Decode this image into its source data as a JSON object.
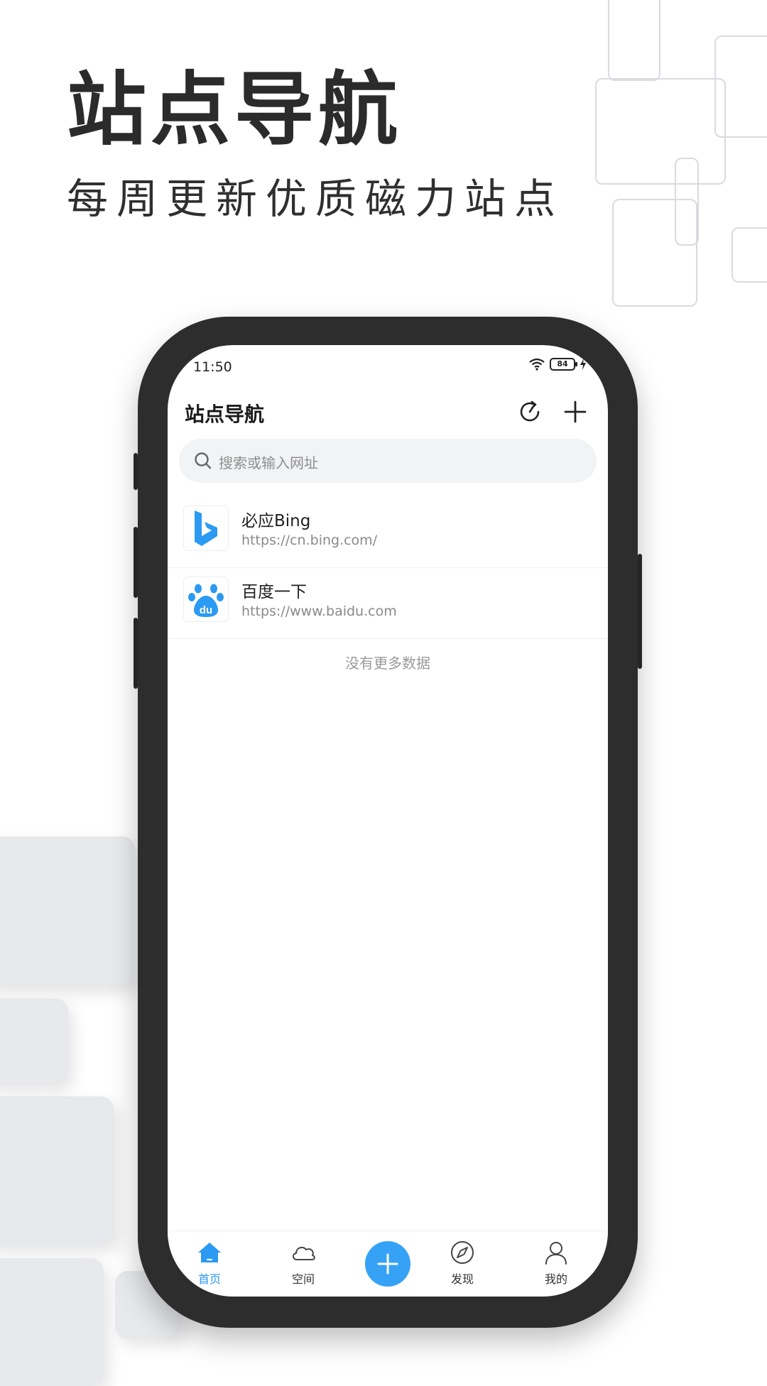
{
  "promo": {
    "title": "站点导航",
    "subtitle": "每周更新优质磁力站点"
  },
  "status_bar": {
    "time": "11:50",
    "battery": "84"
  },
  "app": {
    "title": "站点导航",
    "search_placeholder": "搜索或输入网址",
    "sites": [
      {
        "name": "必应Bing",
        "url": "https://cn.bing.com/",
        "icon": "bing-logo"
      },
      {
        "name": "百度一下",
        "url": "https://www.baidu.com",
        "icon": "baidu-logo"
      }
    ],
    "list_end_text": "没有更多数据"
  },
  "tabbar": {
    "tabs": [
      {
        "label": "首页",
        "icon": "home-icon",
        "active": true
      },
      {
        "label": "空间",
        "icon": "cloud-icon",
        "active": false
      },
      {
        "label": "发现",
        "icon": "compass-icon",
        "active": false
      },
      {
        "label": "我的",
        "icon": "user-icon",
        "active": false
      }
    ]
  },
  "colors": {
    "accent": "#36a2f5",
    "search_bg": "#f2f3f5",
    "phone_frame": "#2d2d2d"
  }
}
